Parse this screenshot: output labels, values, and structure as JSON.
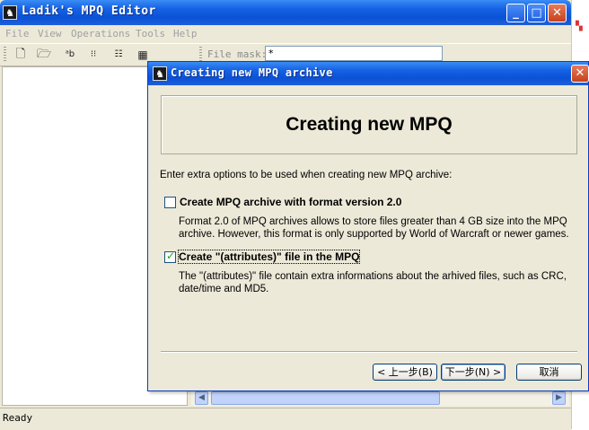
{
  "main_window": {
    "title": "Ladik's MPQ Editor",
    "caption_buttons": {
      "minimize": "_",
      "maximize": "□",
      "close": "✕"
    },
    "menu": [
      "File",
      "View",
      "Operations",
      "Tools",
      "Help"
    ],
    "toolbar": {
      "file_mask_label": "File mask:",
      "file_mask_value": "*"
    },
    "status": "Ready"
  },
  "dialog": {
    "title": "Creating new MPQ archive",
    "close": "✕",
    "header": "Creating new MPQ",
    "intro": "Enter extra options to be used when creating new MPQ archive:",
    "options": [
      {
        "label": "Create MPQ archive with format version 2.0",
        "checked": false,
        "desc_line1": "Format 2.0 of MPQ archives allows to store files greater than 4 GB size into the MPQ",
        "desc_line2": "archive. However, this format is only supported by World of Warcraft or newer games."
      },
      {
        "label": "Create \"(attributes)\" file in the MPQ",
        "checked": true,
        "desc_line1": "The \"(attributes)\" file contain extra informations about the arhived files, such as CRC,",
        "desc_line2": "date/time and MD5."
      }
    ],
    "buttons": {
      "back": "< 上一步(B)",
      "next": "下一步(N) >",
      "cancel": "取消"
    }
  },
  "colors": {
    "titlebar": "#0a52d6",
    "close": "#c6411c",
    "face": "#ece9d8"
  },
  "icons": [
    "app-icon",
    "new-file-icon",
    "open-folder-icon",
    "rename-icon",
    "tree-view-icon",
    "list-view-icon",
    "details-view-icon"
  ]
}
